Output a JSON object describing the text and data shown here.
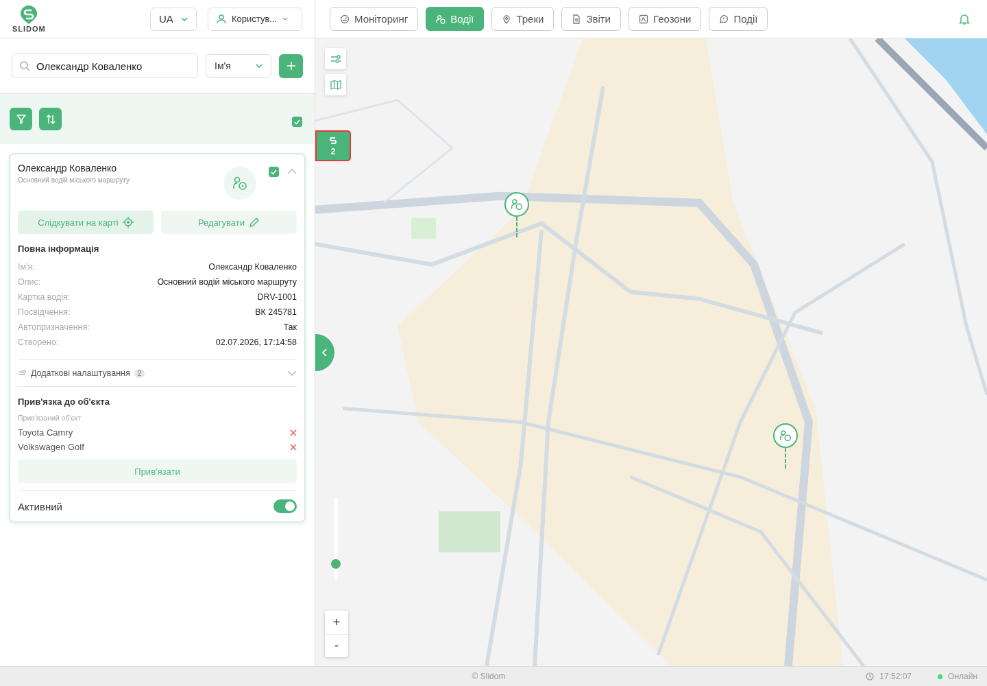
{
  "header": {
    "logo_text": "SLIDOM",
    "language": "UA",
    "user": "Користув..."
  },
  "search": {
    "value": "Олександр Коваленко",
    "field": "Ім'я"
  },
  "toolbar": {
    "select_all_checked": true
  },
  "driver": {
    "name": "Олександр Коваленко",
    "description": "Основний водій міського маршруту",
    "checked": true,
    "expanded": true,
    "buttons": [
      {
        "kind": "track",
        "label": "Слідкувати на карті"
      },
      {
        "kind": "edit",
        "label": "Редагувати"
      }
    ],
    "info_title": "Повна інформація",
    "fields": [
      {
        "label": "Ім'я:",
        "value": "Олександр Коваленко"
      },
      {
        "label": "Опис:",
        "value": "Основний водій міського маршруту"
      },
      {
        "label": "Картка водія:",
        "value": "DRV-1001"
      },
      {
        "label": "Посвідчення:",
        "value": "ВК 245781"
      },
      {
        "label": "Автопризначення:",
        "value": "Так"
      },
      {
        "label": "Створено:",
        "value": "02.07.2026, 17:14:58"
      }
    ],
    "extra_settings": {
      "label": "Додаткові налаштування",
      "count": "2",
      "expanded": false
    },
    "binding": {
      "title": "Прив'язка до об'єкта",
      "subtitle": "Прив'язаний об'єкт",
      "objects": [
        "Toyota Camry",
        "Volkswagen Golf"
      ],
      "button": "Прив'язати"
    },
    "active": {
      "label": "Активний",
      "on": true
    }
  },
  "tabs": [
    {
      "label": "Моніторинг",
      "selected": false
    },
    {
      "label": "Водії",
      "selected": true
    },
    {
      "label": "Треки",
      "selected": false
    },
    {
      "label": "Звіти",
      "selected": false
    },
    {
      "label": "Геозони",
      "selected": false
    },
    {
      "label": "Події",
      "selected": false
    }
  ],
  "map": {
    "cluster_count": "2",
    "zoom_in": "+",
    "zoom_out": "-",
    "zoom_slider": {
      "level": 0.2
    }
  },
  "footer": {
    "copyright": "© Slidom",
    "time": "17:52:07",
    "status": "Онлайн",
    "online": true
  }
}
